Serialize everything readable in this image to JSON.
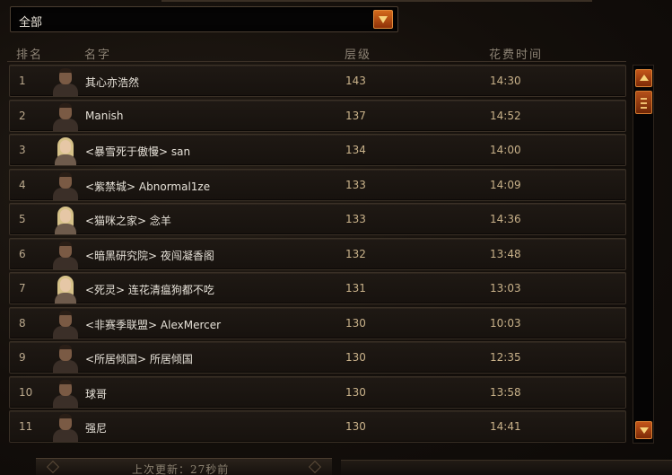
{
  "filter": {
    "selected": "全部"
  },
  "columns": {
    "rank": "排名",
    "name": "名字",
    "level": "层级",
    "time": "花费时间"
  },
  "rows": [
    {
      "rank": "1",
      "name": "其心亦浩然",
      "level": "143",
      "time": "14:30",
      "avatar": "male-portrait-icon"
    },
    {
      "rank": "2",
      "name": "Manish",
      "level": "137",
      "time": "14:52",
      "avatar": "male-portrait-icon"
    },
    {
      "rank": "3",
      "name": "<暴雪死于傲慢> san",
      "level": "134",
      "time": "14:00",
      "avatar": "female-portrait-icon"
    },
    {
      "rank": "4",
      "name": "<紫禁城> Abnormal1ze",
      "level": "133",
      "time": "14:09",
      "avatar": "male-portrait-icon"
    },
    {
      "rank": "5",
      "name": "<猫咪之家> 念羊",
      "level": "133",
      "time": "14:36",
      "avatar": "female-portrait-icon"
    },
    {
      "rank": "6",
      "name": "<暗黑研究院> 夜闯凝香阁",
      "level": "132",
      "time": "13:48",
      "avatar": "male-portrait-icon"
    },
    {
      "rank": "7",
      "name": "<死灵> 连花清瘟狗都不吃",
      "level": "131",
      "time": "13:03",
      "avatar": "female-portrait-icon"
    },
    {
      "rank": "8",
      "name": "<非赛季联盟> AlexMercer",
      "level": "130",
      "time": "10:03",
      "avatar": "male-portrait-icon"
    },
    {
      "rank": "9",
      "name": "<所居倾国> 所居倾国",
      "level": "130",
      "time": "12:35",
      "avatar": "male-portrait-icon"
    },
    {
      "rank": "10",
      "name": "球哥",
      "level": "130",
      "time": "13:58",
      "avatar": "male-portrait-icon"
    },
    {
      "rank": "11",
      "name": "强尼",
      "level": "130",
      "time": "14:41",
      "avatar": "male-portrait-icon"
    }
  ],
  "footer": {
    "last_updated": "上次更新：27秒前"
  },
  "icons": {
    "dropdown": "chevron-down-icon",
    "scroll_up": "arrow-up-icon",
    "scroll_down": "arrow-down-icon"
  },
  "colors": {
    "accent": "#c4561a",
    "text": "#e6e1d8",
    "value": "#c9b28a"
  }
}
